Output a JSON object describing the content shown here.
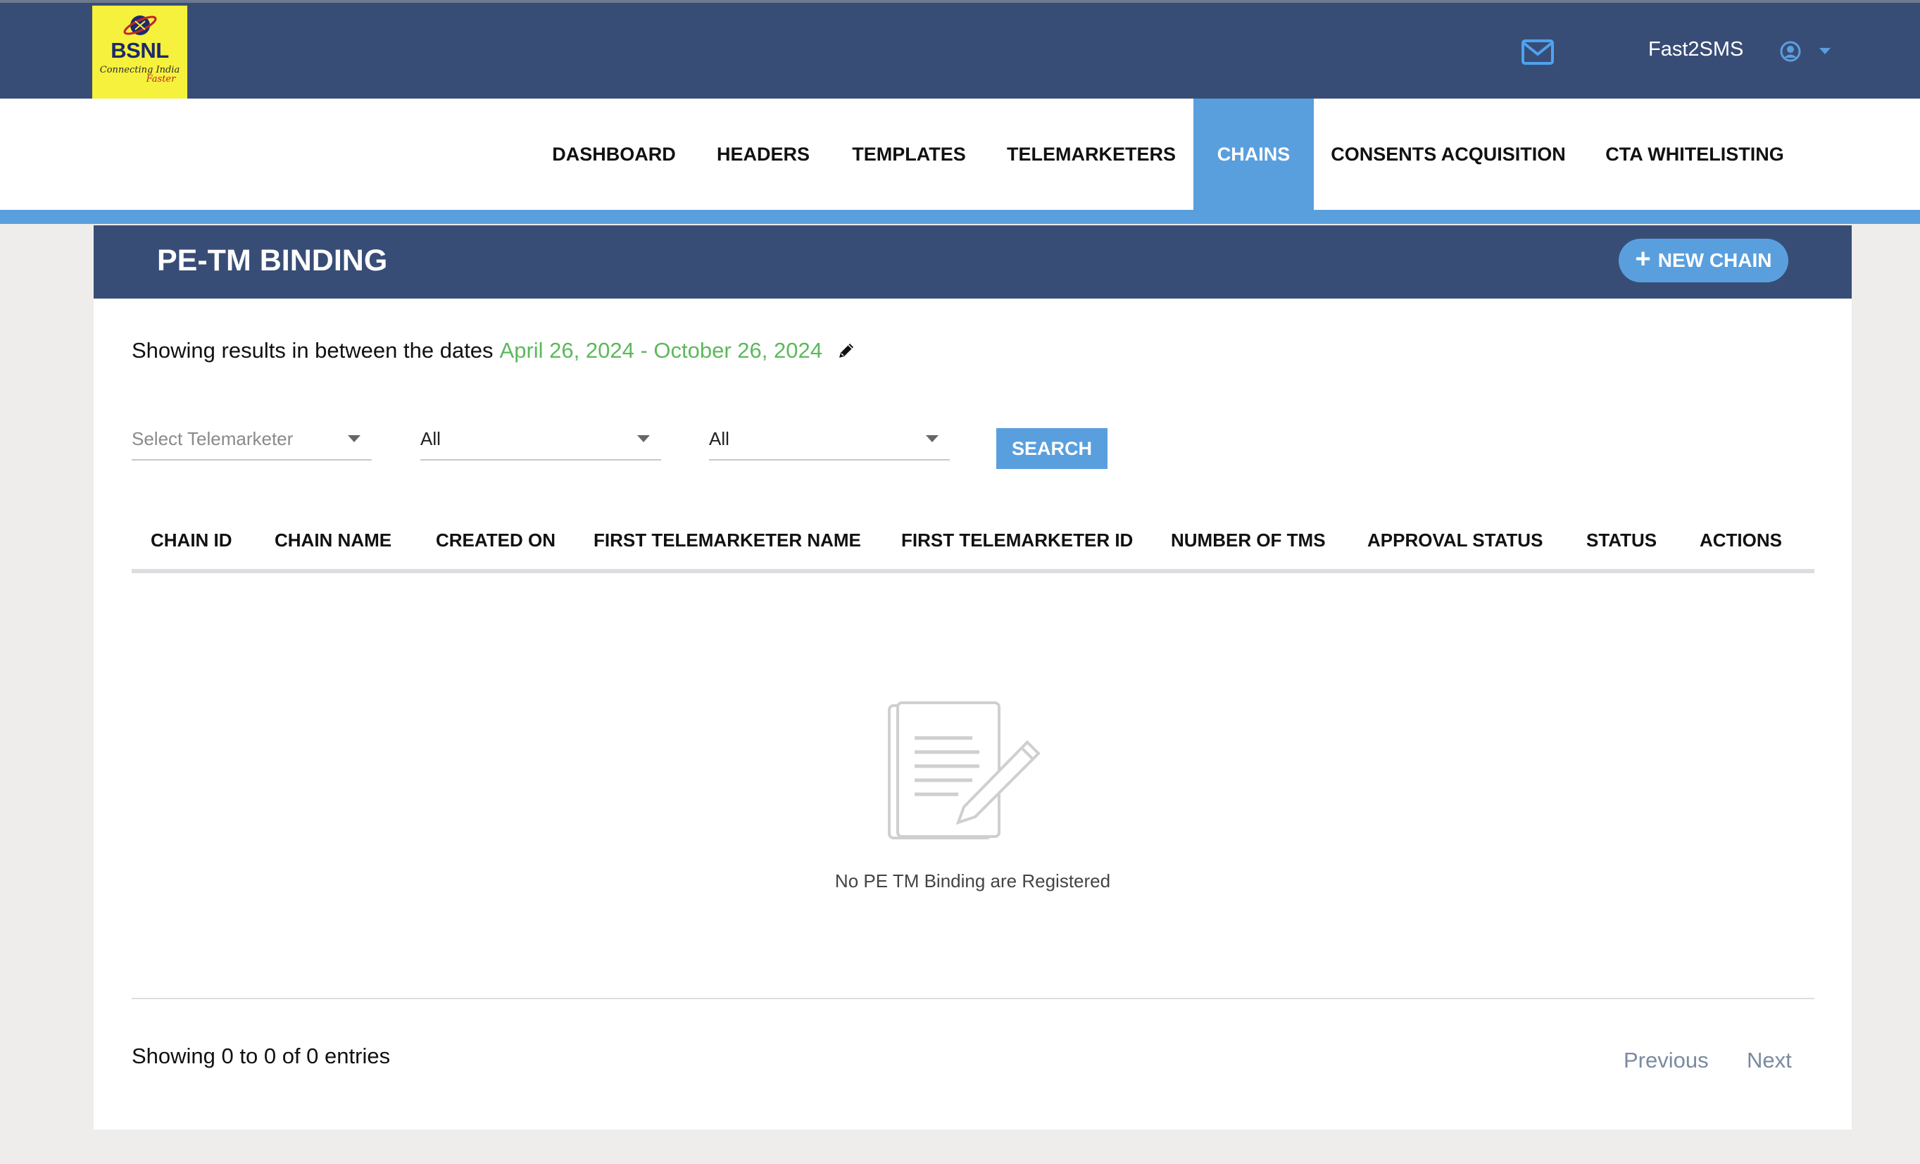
{
  "brand": {
    "name": "BSNL",
    "tagline": "Connecting India",
    "tagline2": "Faster"
  },
  "header": {
    "account_name": "Fast2SMS",
    "icons": [
      "mail-icon",
      "user-circle-icon",
      "caret-down-icon"
    ]
  },
  "nav": {
    "items": [
      {
        "label": "DASHBOARD",
        "active": false
      },
      {
        "label": "HEADERS",
        "active": false
      },
      {
        "label": "TEMPLATES",
        "active": false
      },
      {
        "label": "TELEMARKETERS",
        "active": false
      },
      {
        "label": "CHAINS",
        "active": true
      },
      {
        "label": "CONSENTS ACQUISITION",
        "active": false
      },
      {
        "label": "CTA WHITELISTING",
        "active": false
      }
    ]
  },
  "panel": {
    "title": "PE-TM BINDING",
    "new_button_label": "NEW CHAIN",
    "new_button_icon": "plus-icon"
  },
  "filters": {
    "date_prefix": "Showing results in between the dates",
    "date_range": "April 26, 2024 - October 26, 2024",
    "telemarketer_placeholder": "Select Telemarketer",
    "filter2_value": "All",
    "filter3_value": "All",
    "search_label": "SEARCH"
  },
  "table": {
    "columns": [
      "CHAIN ID",
      "CHAIN NAME",
      "CREATED ON",
      "FIRST TELEMARKETER NAME",
      "FIRST TELEMARKETER ID",
      "NUMBER OF TMS",
      "APPROVAL STATUS",
      "STATUS",
      "ACTIONS"
    ],
    "rows": [],
    "empty_message": "No PE TM Binding are Registered"
  },
  "footer": {
    "entries_text": "Showing 0 to 0 of 0 entries",
    "previous_label": "Previous",
    "next_label": "Next"
  },
  "colors": {
    "header_bg": "#384d76",
    "accent": "#5a9fdd",
    "date_green": "#5cb85c",
    "logo_bg": "#f6f13c"
  }
}
